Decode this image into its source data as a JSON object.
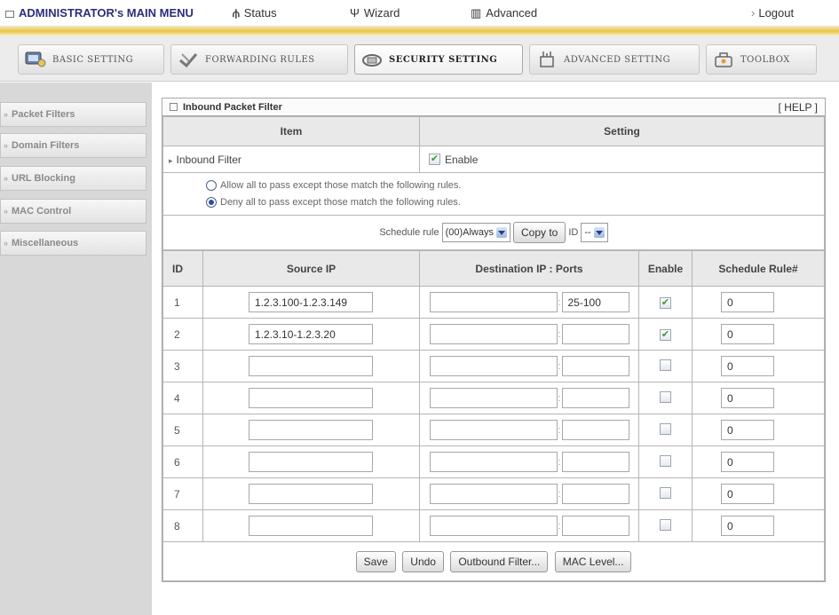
{
  "topbar": {
    "menu_title": "ADMINISTRATOR's MAIN MENU",
    "status": "Status",
    "wizard": "Wizard",
    "advanced": "Advanced",
    "logout": "Logout"
  },
  "tabs": [
    {
      "label": "BASIC SETTING",
      "icon": "monitor-icon",
      "active": false
    },
    {
      "label": "FORWARDING RULES",
      "icon": "forward-icon",
      "active": false
    },
    {
      "label": "SECURITY SETTING",
      "icon": "lock-icon",
      "active": true
    },
    {
      "label": "ADVANCED SETTING",
      "icon": "antenna-icon",
      "active": false
    },
    {
      "label": "TOOLBOX",
      "icon": "toolbox-icon",
      "active": false
    }
  ],
  "sidebar": {
    "items": [
      {
        "label": "Packet Filters"
      },
      {
        "label": "Domain Filters"
      },
      {
        "label": "URL Blocking"
      },
      {
        "label": "MAC Control"
      },
      {
        "label": "Miscellaneous"
      }
    ]
  },
  "panel": {
    "title": "Inbound Packet Filter",
    "help": "[ HELP ]",
    "item_header": "Item",
    "setting_header": "Setting",
    "filter_label": "Inbound Filter",
    "enable_label": "Enable",
    "enable_checked": true,
    "radio_allow": "Allow all to pass except those match the following rules.",
    "radio_deny": "Deny all to pass except those match the following rules.",
    "selected_mode": "deny",
    "schedule_label": "Schedule rule",
    "schedule_value": "(00)Always",
    "copy_button": "Copy to",
    "id_label": "ID",
    "id_value": "--"
  },
  "rules": {
    "columns": {
      "id": "ID",
      "source": "Source IP",
      "dest": "Destination IP : Ports",
      "enable": "Enable",
      "schedule": "Schedule Rule#"
    },
    "rows": [
      {
        "id": "1",
        "source": "1.2.3.100-1.2.3.149",
        "dest_ip": "",
        "ports": "25-100",
        "enabled": true,
        "schedule": "0"
      },
      {
        "id": "2",
        "source": "1.2.3.10-1.2.3.20",
        "dest_ip": "",
        "ports": "",
        "enabled": true,
        "schedule": "0"
      },
      {
        "id": "3",
        "source": "",
        "dest_ip": "",
        "ports": "",
        "enabled": false,
        "schedule": "0"
      },
      {
        "id": "4",
        "source": "",
        "dest_ip": "",
        "ports": "",
        "enabled": false,
        "schedule": "0"
      },
      {
        "id": "5",
        "source": "",
        "dest_ip": "",
        "ports": "",
        "enabled": false,
        "schedule": "0"
      },
      {
        "id": "6",
        "source": "",
        "dest_ip": "",
        "ports": "",
        "enabled": false,
        "schedule": "0"
      },
      {
        "id": "7",
        "source": "",
        "dest_ip": "",
        "ports": "",
        "enabled": false,
        "schedule": "0"
      },
      {
        "id": "8",
        "source": "",
        "dest_ip": "",
        "ports": "",
        "enabled": false,
        "schedule": "0"
      }
    ]
  },
  "footer": {
    "save": "Save",
    "undo": "Undo",
    "outbound": "Outbound Filter...",
    "mac_level": "MAC Level..."
  }
}
